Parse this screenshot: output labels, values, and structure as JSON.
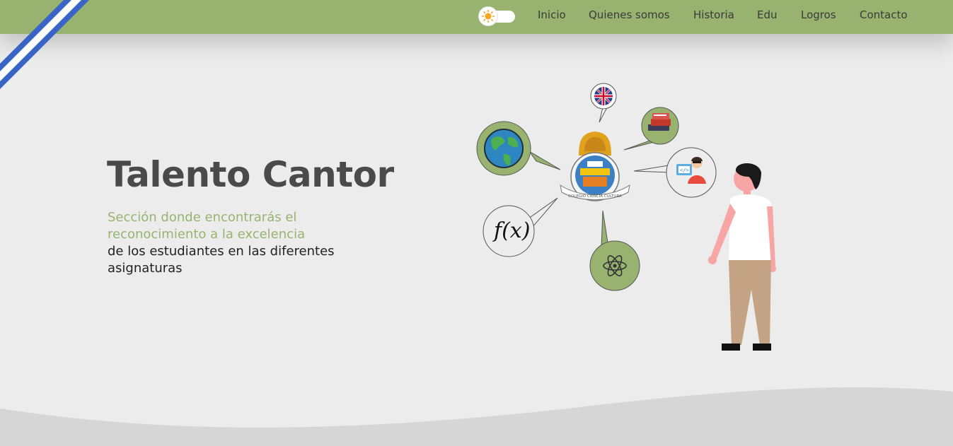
{
  "nav": {
    "theme_toggle": {
      "icon": "sun-icon",
      "state": "light"
    },
    "links": [
      "Inicio",
      "Quienes somos",
      "Historia",
      "Edu",
      "Logros",
      "Contacto"
    ]
  },
  "hero": {
    "title": "Talento Cantor",
    "description_highlight_1": "Sección donde encontrarás el",
    "description_highlight_2": "reconocimiento a la excelencia",
    "description_1": "de los estudiantes en las diferentes",
    "description_2": "asignaturas"
  },
  "illustration": {
    "emblem_caption": "COLEGIO CIENCIA CULTURA",
    "math_bubble": "f(x)",
    "icons": [
      "uk-flag-icon",
      "books-icon",
      "globe-icon",
      "programmer-icon",
      "function-icon",
      "atom-icon",
      "school-emblem-icon",
      "student-figure"
    ]
  },
  "colors": {
    "nav_bg": "#98b36f",
    "accent": "#98b36f",
    "page_bg": "#ececec",
    "title": "#4a4a4a",
    "flag_blue": "#3a63c8"
  }
}
